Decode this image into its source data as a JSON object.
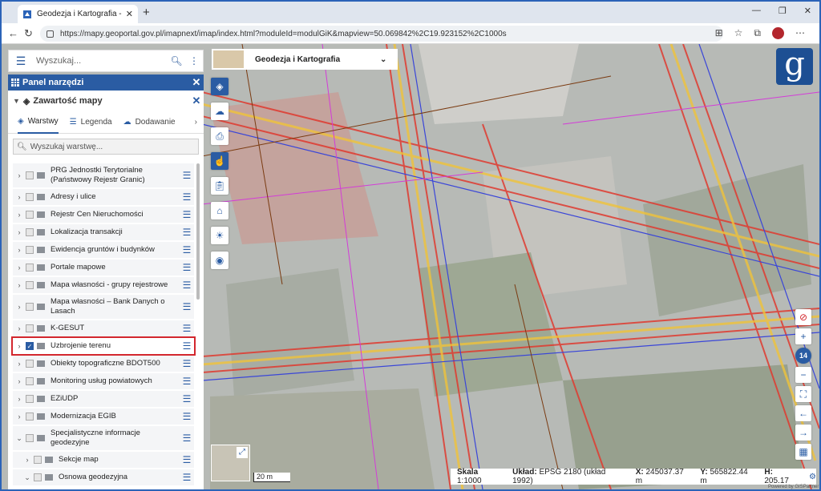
{
  "browser": {
    "tab_title": "Geodezja i Kartografia - Geoportal",
    "url": "https://mapy.geoportal.gov.pl/imapnext/imap/index.html?moduleId=modulGiK&mapview=50.069842%2C19.923152%2C1000s"
  },
  "search": {
    "placeholder": "Wyszukaj..."
  },
  "panel": {
    "title": "Panel narzędzi",
    "section_title": "Zawartość mapy",
    "tabs": [
      {
        "label": "Warstwy",
        "icon": "layers-icon",
        "active": true
      },
      {
        "label": "Legenda",
        "icon": "list-icon",
        "active": false
      },
      {
        "label": "Dodawanie",
        "icon": "cloud-icon",
        "active": false
      }
    ],
    "layer_search_placeholder": "Wyszukaj warstwę...",
    "layers": [
      {
        "label": "PRG Jednostki Terytorialne (Państwowy Rejestr Granic)",
        "checked": false,
        "indent": 0
      },
      {
        "label": "Adresy i ulice",
        "checked": false,
        "indent": 0
      },
      {
        "label": "Rejestr Cen Nieruchomości",
        "checked": false,
        "indent": 0
      },
      {
        "label": "Lokalizacja transakcji",
        "checked": false,
        "indent": 0
      },
      {
        "label": "Ewidencja gruntów i budynków",
        "checked": false,
        "indent": 0
      },
      {
        "label": "Portale mapowe",
        "checked": false,
        "indent": 0
      },
      {
        "label": "Mapa własności - grupy rejestrowe",
        "checked": false,
        "indent": 0
      },
      {
        "label": "Mapa własności – Bank Danych o Lasach",
        "checked": false,
        "indent": 0
      },
      {
        "label": "K-GESUT",
        "checked": false,
        "indent": 0
      },
      {
        "label": "Uzbrojenie terenu",
        "checked": true,
        "indent": 0,
        "highlighted": true
      },
      {
        "label": "Obiekty topograficzne BDOT500",
        "checked": false,
        "indent": 0
      },
      {
        "label": "Monitoring usług powiatowych",
        "checked": false,
        "indent": 0
      },
      {
        "label": "EZiUDP",
        "checked": false,
        "indent": 0
      },
      {
        "label": "Modernizacja EGIB",
        "checked": false,
        "indent": 0
      },
      {
        "label": "Specjalistyczne informacje geodezyjne",
        "checked": false,
        "indent": 0,
        "expanded": true
      },
      {
        "label": "Sekcje map",
        "checked": false,
        "indent": 1
      },
      {
        "label": "Osnowa geodezyjna",
        "checked": false,
        "indent": 1,
        "expanded": true
      }
    ]
  },
  "topic": {
    "label": "Geodezja i Kartografia"
  },
  "logo": {
    "letter": "g"
  },
  "zoom_level": "14",
  "scale_bar": "20 m",
  "status": {
    "scale_label": "Skala",
    "scale_value": "1:1000",
    "crs_label": "Układ:",
    "crs_value": "EPSG 2180 (układ 1992)",
    "x_label": "X:",
    "x_value": "245037.37 m",
    "y_label": "Y:",
    "y_value": "565822.44 m",
    "h_label": "H:",
    "h_value": "205.17",
    "powered": "Powered by GISPartner"
  },
  "colors": {
    "brand": "#2a5ca3",
    "highlight": "#d3272e"
  }
}
